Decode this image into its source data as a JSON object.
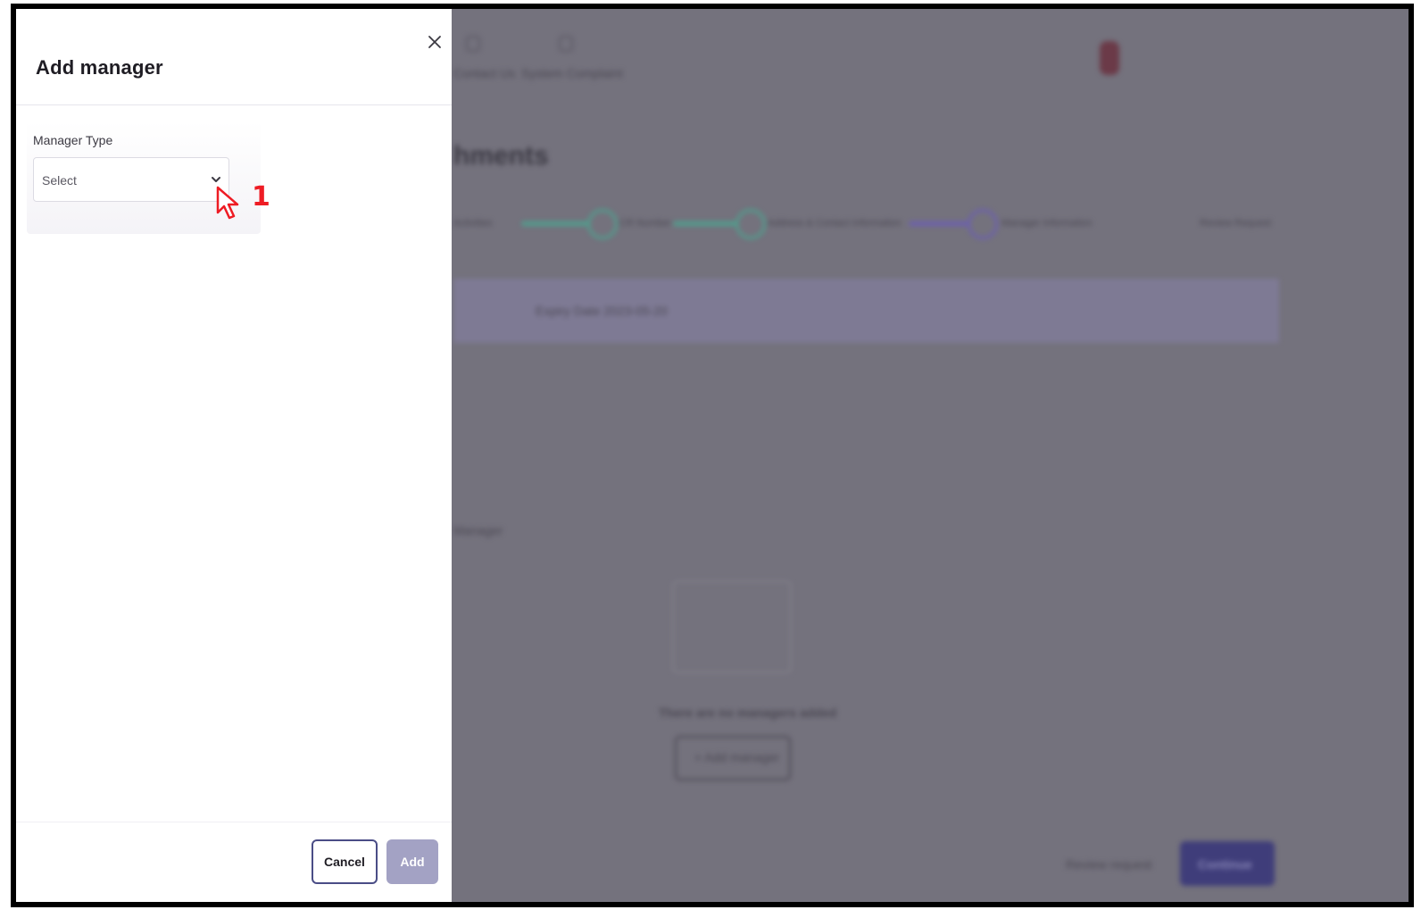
{
  "dialog": {
    "title": "Add manager",
    "field_label": "Manager Type",
    "select_placeholder": "Select",
    "cancel_label": "Cancel",
    "add_label": "Add"
  },
  "annotation": {
    "step_number": "1",
    "color": "#ee1c24"
  },
  "background": {
    "nav_items": [
      "Contact Us",
      "System Complaint"
    ],
    "page_heading": "hments",
    "steps": [
      "Activities",
      "CR Number",
      "Address & Contact Information",
      "Manager Information",
      "Review Request"
    ],
    "banner_text": "Expiry Date 2023-05-20",
    "section_label": "Manager",
    "empty_message": "There are no managers added",
    "add_manager_label": "+ Add manager",
    "review_label": "Review request",
    "continue_label": "Continue"
  },
  "colors": {
    "overlay": "#74727d",
    "primary": "#4a4d86",
    "disabled": "#a3a2c4",
    "step_done": "#4fa08e"
  }
}
